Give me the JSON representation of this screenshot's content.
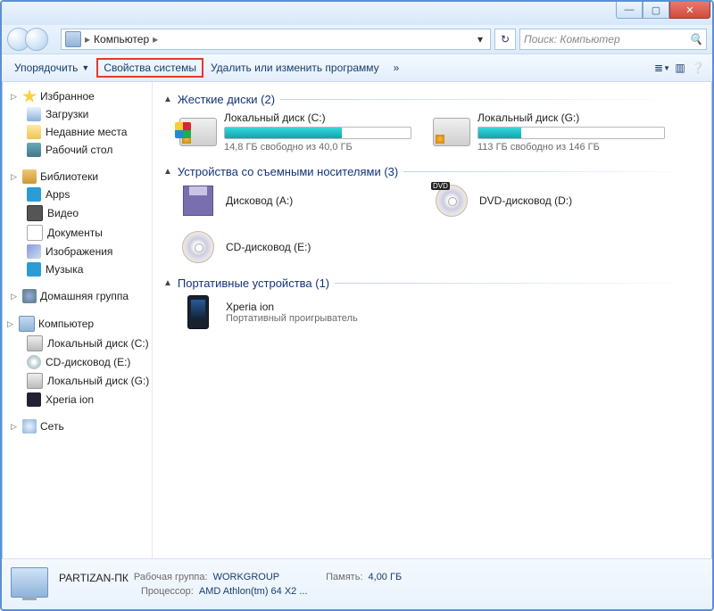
{
  "breadcrumb": {
    "root_icon": "computer",
    "path": "Компьютер",
    "sep": "▸"
  },
  "search": {
    "placeholder": "Поиск: Компьютер"
  },
  "toolbar": {
    "organize": "Упорядочить",
    "system_props": "Свойства системы",
    "uninstall": "Удалить или изменить программу",
    "more": "»"
  },
  "sidebar": {
    "favorites": {
      "label": "Избранное",
      "items": [
        {
          "label": "Загрузки"
        },
        {
          "label": "Недавние места"
        },
        {
          "label": "Рабочий стол"
        }
      ]
    },
    "libraries": {
      "label": "Библиотеки",
      "items": [
        {
          "label": "Apps"
        },
        {
          "label": "Видео"
        },
        {
          "label": "Документы"
        },
        {
          "label": "Изображения"
        },
        {
          "label": "Музыка"
        }
      ]
    },
    "homegroup": {
      "label": "Домашняя группа"
    },
    "computer": {
      "label": "Компьютер",
      "items": [
        {
          "label": "Локальный диск (C:)"
        },
        {
          "label": "CD-дисковод (E:)"
        },
        {
          "label": "Локальный диск (G:)"
        },
        {
          "label": "Xperia ion"
        }
      ]
    },
    "network": {
      "label": "Сеть"
    }
  },
  "sections": {
    "hdd": {
      "title": "Жесткие диски (2)",
      "drives": [
        {
          "name": "Локальный диск (C:)",
          "sub": "14,8 ГБ свободно из 40,0 ГБ",
          "fill": 63
        },
        {
          "name": "Локальный диск (G:)",
          "sub": "113 ГБ свободно из 146 ГБ",
          "fill": 23
        }
      ]
    },
    "removable": {
      "title": "Устройства со съемными носителями (3)",
      "devices": [
        {
          "name": "Дисковод (A:)",
          "kind": "floppy"
        },
        {
          "name": "DVD-дисковод (D:)",
          "kind": "dvd"
        },
        {
          "name": "CD-дисковод (E:)",
          "kind": "cd"
        }
      ]
    },
    "portable": {
      "title": "Портативные устройства (1)",
      "devices": [
        {
          "name": "Xperia ion",
          "sub": "Портативный проигрыватель",
          "kind": "phone"
        }
      ]
    }
  },
  "status": {
    "name": "PARTIZAN-ПК",
    "workgroup_label": "Рабочая группа:",
    "workgroup": "WORKGROUP",
    "cpu_label": "Процессор:",
    "cpu": "AMD Athlon(tm) 64 X2 ...",
    "mem_label": "Память:",
    "mem": "4,00 ГБ"
  }
}
